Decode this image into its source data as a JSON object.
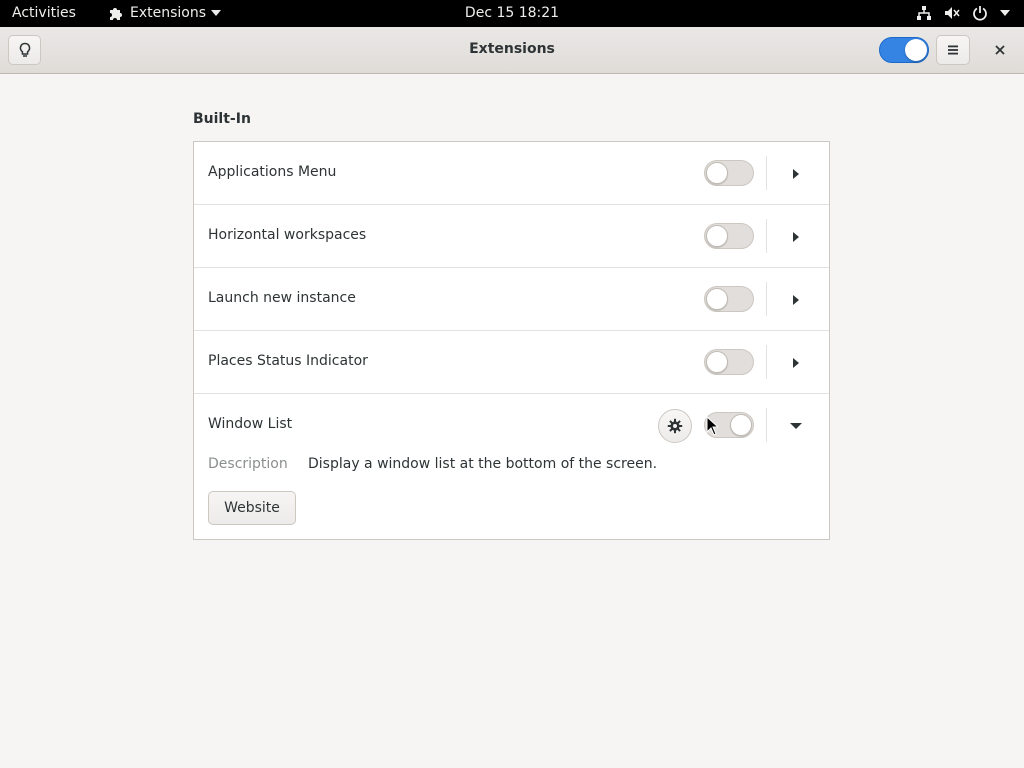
{
  "topbar": {
    "activities": "Activities",
    "app_menu": "Extensions",
    "clock": "Dec 15  18:21",
    "icons": [
      "network-icon",
      "volume-muted-icon",
      "power-icon",
      "chevron-down-icon"
    ]
  },
  "window": {
    "title": "Extensions",
    "master_switch_on": true
  },
  "section": {
    "title": "Built-In"
  },
  "extensions": [
    {
      "name": "Applications Menu",
      "enabled": false,
      "expanded": false
    },
    {
      "name": "Horizontal workspaces",
      "enabled": false,
      "expanded": false
    },
    {
      "name": "Launch new instance",
      "enabled": false,
      "expanded": false
    },
    {
      "name": "Places Status Indicator",
      "enabled": false,
      "expanded": false
    },
    {
      "name": "Window List",
      "enabled": false,
      "expanded": true,
      "description_label": "Description",
      "description": "Display a window list at the bottom of the screen.",
      "website_label": "Website"
    }
  ],
  "colors": {
    "accent": "#3584e4",
    "background": "#f6f5f4",
    "topbar": "#000000"
  }
}
